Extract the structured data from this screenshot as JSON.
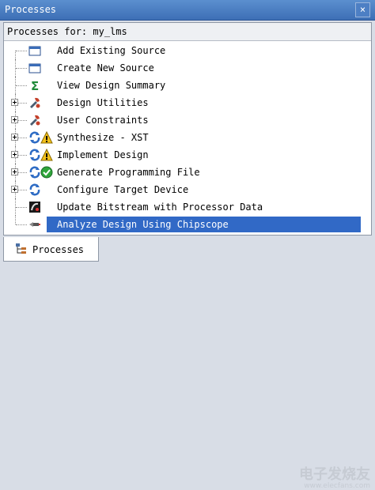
{
  "window": {
    "title": "Processes",
    "close_glyph": "×"
  },
  "panel": {
    "header": "Processes for: my_lms"
  },
  "tree": [
    {
      "label": "Add Existing Source",
      "icon": "window-icon",
      "expandable": false
    },
    {
      "label": "Create New Source",
      "icon": "window-icon",
      "expandable": false
    },
    {
      "label": "View Design Summary",
      "icon": "sigma-icon",
      "expandable": false
    },
    {
      "label": "Design Utilities",
      "icon": "tools-icon",
      "expandable": true
    },
    {
      "label": "User Constraints",
      "icon": "tools-icon",
      "expandable": true
    },
    {
      "label": "Synthesize - XST",
      "icon": "refresh-warning-icon",
      "expandable": true
    },
    {
      "label": "Implement Design",
      "icon": "refresh-warning-icon",
      "expandable": true
    },
    {
      "label": "Generate Programming File",
      "icon": "refresh-ok-icon",
      "expandable": true
    },
    {
      "label": "Configure Target Device",
      "icon": "refresh-icon",
      "expandable": true
    },
    {
      "label": "Update Bitstream with Processor Data",
      "icon": "chip-icon",
      "expandable": false
    },
    {
      "label": "Analyze Design Using Chipscope",
      "icon": "probe-icon",
      "expandable": false,
      "selected": true
    }
  ],
  "tabs": [
    {
      "label": "Processes",
      "icon": "process-tree-icon",
      "active": true
    }
  ],
  "watermark": {
    "logo": "电子发烧友",
    "url": "www.elecfans.com"
  },
  "colors": {
    "selection": "#3169c6",
    "titlebar": "#4a7ec3"
  }
}
